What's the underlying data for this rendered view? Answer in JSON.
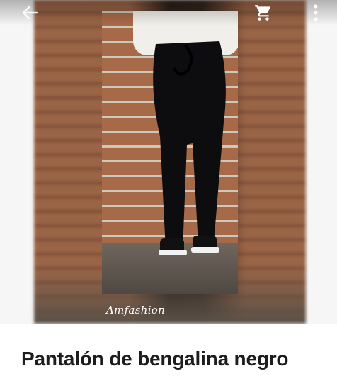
{
  "product": {
    "title": "Pantalón de bengalina negro",
    "watermark": "Amfashion"
  },
  "topbar": {
    "back_icon": "arrow-left-icon",
    "cart_icon": "shopping-cart-icon",
    "menu_icon": "more-vertical-icon"
  },
  "colors": {
    "title_text": "#1d1d1d",
    "icon_white": "#ffffff"
  }
}
